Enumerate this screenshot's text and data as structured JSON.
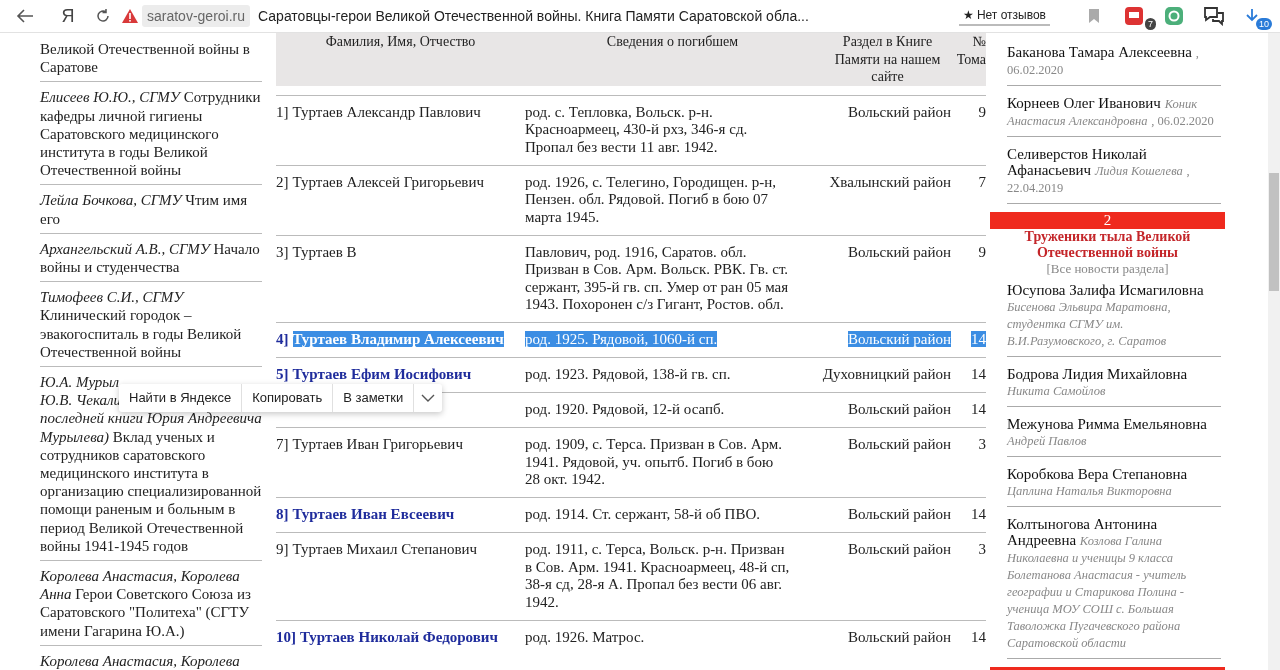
{
  "browser": {
    "logo": "Я",
    "address": "saratov-geroi.ru",
    "title": "Саратовцы-герои Великой Отечественной войны. Книга Памяти Саратовской обла...",
    "reviews": "★ Нет отзывов",
    "adblock_badge": "7",
    "downloads_badge": "10"
  },
  "left_articles": [
    {
      "text": "Великой Отечественной войны в Саратове"
    },
    {
      "text": "*Елисеев Ю.Ю., СГМУ* Сотрудники кафедры личной гигиены Саратовского медицинского института в годы Великой Отечественной войны"
    },
    {
      "text": "*Лейла Бочкова, СГМУ* Чтим имя его"
    },
    {
      "text": "*Архангельский А.В., СГМУ* Начало войны и студенчества"
    },
    {
      "text": "*Тимофеев С.И., СГМУ* Клинический городок – эвакогоспиталь в годы Великой Отечественной войны"
    },
    {
      "cut_lines": [
        "*Ю.А. Мурыл*",
        "*Ю.В. Чекали*"
      ],
      "text": "*последней книги Юрия Андреевича Мурылева)* Вклад ученых и сотрудников саратовского медицинского института в организацию специализированной помощи раненым и больным в период Великой Отечественной войны 1941-1945 годов"
    },
    {
      "text": "*Королева Анастасия, Королева Анна* Герои Советского Союза из Саратовского \"Политеха\" (СГТУ имени Гагарина Ю.А.)"
    },
    {
      "text": "*Королева Анастасия, Королева*"
    }
  ],
  "table": {
    "columns": [
      "Фамилия, Имя, Отчество",
      "Сведения о погибшем",
      "Раздел в Книге Памяти на нашем сайте",
      "№ Тома"
    ],
    "rows": [
      {
        "kind": "plain",
        "selected": false,
        "number": "1]",
        "name": "Туртаев Александр Павлович",
        "info": "род. с. Тепловка, Вольск. р-н. Красноармеец, 430-й рхз, 346-я сд. Пропал без вести 11 авг. 1942.",
        "section": "Вольский район",
        "volume": "9"
      },
      {
        "kind": "plain",
        "selected": false,
        "number": "2]",
        "name": "Туртаев Алексей Григорьевич",
        "info": "род. 1926, с. Телегино, Городищен. р-н, Пензен. обл. Рядовой. Погиб в бою 07 марта 1945.",
        "section": "Хвалынский район",
        "volume": "7"
      },
      {
        "kind": "plain",
        "selected": false,
        "number": "3]",
        "name": "Туртаев В",
        "info": "Павлович, род. 1916, Саратов. обл. Призван в Сов. Арм. Вольск. РВК. Гв. ст. сержант, 395-й гв. сп. Умер от ран 05 мая 1943. Похоронен с/з Гигант, Ростов. обл.",
        "section": "Вольский район",
        "volume": "9"
      },
      {
        "kind": "link",
        "selected": true,
        "number": "4]",
        "name": "Туртаев Владимир Алексеевич",
        "info": "род. 1925. Рядовой, 1060-й сп.",
        "section": "Вольский район",
        "volume": "14"
      },
      {
        "kind": "link",
        "selected": false,
        "number": "5]",
        "name": "Туртаев Ефим Иосифович",
        "info": "род. 1923. Рядовой, 138-й гв. сп.",
        "section": "Духовницкий район",
        "volume": "14"
      },
      {
        "kind": "link",
        "selected": false,
        "info": "род. 1920. Рядовой, 12-й осапб.",
        "section": "Вольский район",
        "volume": "14"
      },
      {
        "kind": "plain",
        "selected": false,
        "number": "7]",
        "name": "Туртаев Иван Григорьевич",
        "info": "род. 1909, с. Терса. Призван в Сов. Арм. 1941. Рядовой, уч. опытб. Погиб в бою 28 окт. 1942.",
        "section": "Вольский район",
        "volume": "3"
      },
      {
        "kind": "link",
        "selected": false,
        "number": "8]",
        "name": "Туртаев Иван Евсеевич",
        "info": "род. 1914. Ст. сержант, 58-й об ПВО.",
        "section": "Вольский район",
        "volume": "14"
      },
      {
        "kind": "plain",
        "selected": false,
        "number": "9]",
        "name": "Туртаев Михаил Степанович",
        "info": "род. 1911, с. Терса, Вольск. р-н. Призван в Сов. Арм. 1941. Красноармеец, 48-й сп, 38-я сд, 28-я А. Пропал без вести 06 авг. 1942.",
        "section": "Вольский район",
        "volume": "3"
      },
      {
        "kind": "link",
        "selected": false,
        "number": "10]",
        "name": "Туртаев Николай Федорович",
        "info": "род. 1926. Матрос.",
        "section": "Вольский район",
        "volume": "14"
      }
    ]
  },
  "right_column": [
    {
      "kind": "entry",
      "name": "Баканова Тамара Алексеевна",
      "date": ", 06.02.2020"
    },
    {
      "kind": "entry",
      "name": "Корнеев Олег Иванович",
      "author": "Коник Анастасия Александровна",
      "date": ", 06.02.2020"
    },
    {
      "kind": "entry",
      "name": "Селиверстов Николай Афанасьевич",
      "author": "Лидия Кошелева",
      "date": ", 22.04.2019"
    },
    {
      "kind": "rubric",
      "number": "2",
      "title": "Труженики тыла Великой Отечественной войны",
      "link": "[Все новости раздела]"
    },
    {
      "kind": "entry",
      "name": "Юсупова Залифа Исмагиловна",
      "author": "Бисенова Эльвира Маратовна, студентка СГМУ им. В.И.Разумовского, г. Саратов"
    },
    {
      "kind": "entry",
      "name": "Бодрова Лидия Михайловна",
      "author": "Никита Самойлов"
    },
    {
      "kind": "entry",
      "name": "Межунова Римма Емельяновна",
      "author": "Андрей Павлов"
    },
    {
      "kind": "entry",
      "name": "Коробкова Вера Степановна",
      "author": "Цаплина Наталья Викторовна"
    },
    {
      "kind": "entry",
      "name": "Колтыногова Антонина Андреевна",
      "author": "Козлова Галина Николаевна и ученицы 9 класса Болетанова Анастасия - учитель географии и Старикова Полина - ученица МОУ СОШ с. Большая Таволожка Пугачевского района Саратовской области"
    },
    {
      "kind": "rubric"
    }
  ],
  "context_menu": {
    "items": [
      "Найти в Яндексе",
      "Копировать",
      "В заметки"
    ]
  }
}
